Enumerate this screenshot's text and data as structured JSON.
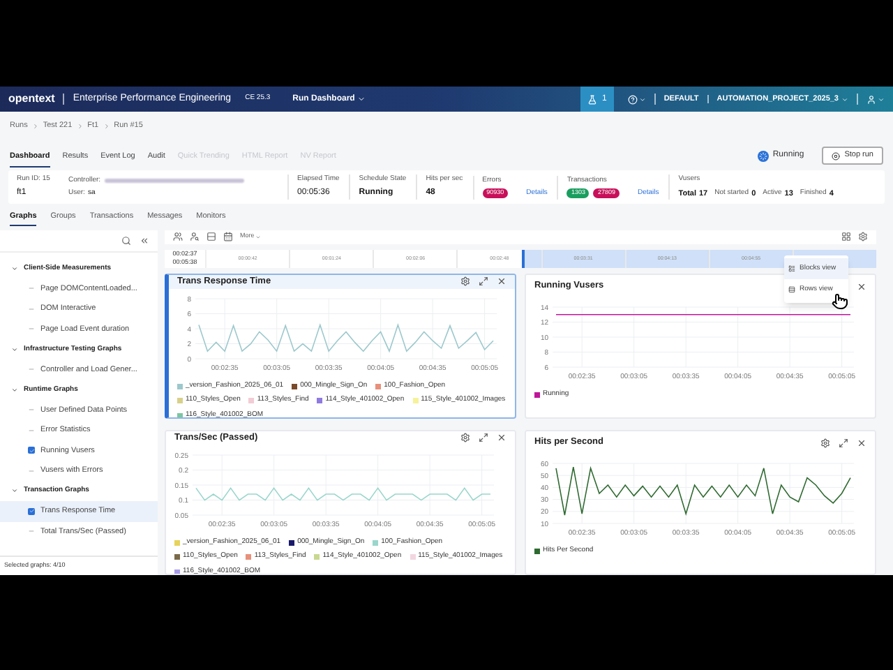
{
  "header": {
    "logo": "opentext",
    "product": "Enterprise Performance Engineering",
    "edition": "CE 25.3",
    "menu": "Run Dashboard",
    "notifications": "1",
    "domain": "DEFAULT",
    "project": "AUTOMATION_PROJECT_2025_3"
  },
  "breadcrumb": [
    "Runs",
    "Test 221",
    "Ft1",
    "Run #15"
  ],
  "tabs": [
    {
      "label": "Dashboard",
      "selected": true,
      "disabled": false
    },
    {
      "label": "Results",
      "selected": false,
      "disabled": false
    },
    {
      "label": "Event Log",
      "selected": false,
      "disabled": false
    },
    {
      "label": "Audit",
      "selected": false,
      "disabled": false
    },
    {
      "label": "Quick Trending",
      "selected": false,
      "disabled": true
    },
    {
      "label": "HTML Report",
      "selected": false,
      "disabled": true
    },
    {
      "label": "NV Report",
      "selected": false,
      "disabled": true
    }
  ],
  "run_status": "Running",
  "stop_button": "Stop run",
  "summary": {
    "run_id_label": "Run ID: 15",
    "run_name": "ft1",
    "controller_label": "Controller:",
    "user_label": "User:",
    "user": "sa",
    "elapsed_label": "Elapsed Time",
    "elapsed": "00:05:36",
    "schedule_label": "Schedule State",
    "schedule": "Running",
    "hits_label": "Hits per sec",
    "hits": "48",
    "errors_label": "Errors",
    "errors_badges": [
      {
        "text": "90930",
        "color": "#c8105a"
      }
    ],
    "errors_link": "Details",
    "transactions_label": "Transactions",
    "transactions_badges": [
      {
        "text": "1303",
        "color": "#1a9e5f"
      },
      {
        "text": "27809",
        "color": "#c8105a"
      }
    ],
    "transactions_link": "Details",
    "vusers_label": "Vusers",
    "vusers": [
      {
        "label": "Total",
        "value": "17"
      },
      {
        "label": "Not started",
        "value": "0"
      },
      {
        "label": "Active",
        "value": "13"
      },
      {
        "label": "Finished",
        "value": "4"
      }
    ]
  },
  "sub_tabs": [
    {
      "label": "Graphs",
      "selected": true
    },
    {
      "label": "Groups",
      "selected": false
    },
    {
      "label": "Transactions",
      "selected": false
    },
    {
      "label": "Messages",
      "selected": false
    },
    {
      "label": "Monitors",
      "selected": false
    }
  ],
  "sidebar": {
    "groups": [
      {
        "label": "Client-Side Measurements",
        "expanded": true,
        "children": [
          {
            "label": "Page DOMContentLoaded...",
            "checked": false,
            "selected": false
          },
          {
            "label": "DOM Interactive",
            "checked": false,
            "selected": false
          },
          {
            "label": "Page Load Event duration",
            "checked": false,
            "selected": false
          }
        ]
      },
      {
        "label": "Infrastructure Testing Graphs",
        "expanded": true,
        "children": [
          {
            "label": "Controller and Load Gener...",
            "checked": false,
            "selected": false
          }
        ]
      },
      {
        "label": "Runtime Graphs",
        "expanded": true,
        "children": [
          {
            "label": "User Defined Data Points",
            "checked": false,
            "selected": false
          },
          {
            "label": "Error Statistics",
            "checked": false,
            "selected": false
          },
          {
            "label": "Running Vusers",
            "checked": true,
            "selected": false
          },
          {
            "label": "Vusers with Errors",
            "checked": false,
            "selected": false
          }
        ]
      },
      {
        "label": "Transaction Graphs",
        "expanded": true,
        "children": [
          {
            "label": "Trans Response Time",
            "checked": true,
            "selected": true
          },
          {
            "label": "Total Trans/Sec (Passed)",
            "checked": false,
            "selected": false
          }
        ]
      }
    ],
    "footer": "Selected graphs: 4/10"
  },
  "toolbar": {
    "more": "More"
  },
  "timeline": {
    "start": "00:02:37",
    "end": "00:05:38",
    "level": 0.53,
    "ticks": [
      "00:00:42",
      "00:01:24",
      "00:02:06",
      "00:02:48",
      "00:03:31",
      "00:04:13",
      "00:04:55"
    ]
  },
  "view_menu": [
    {
      "label": "Blocks view",
      "selected": true
    },
    {
      "label": "Rows view",
      "selected": false
    }
  ],
  "charts": [
    {
      "title": "Trans Response Time",
      "selected": true,
      "chart_data": {
        "type": "line",
        "grid": true,
        "x": [
          140,
          145,
          150,
          155,
          160,
          165,
          170,
          175,
          180,
          185,
          190,
          195,
          200,
          205,
          210,
          215,
          220,
          225,
          230,
          235,
          240,
          245,
          250,
          255,
          260,
          265,
          270,
          275,
          280,
          285,
          290,
          295,
          300,
          305,
          310
        ],
        "xlim": [
          138,
          312
        ],
        "ylim": [
          0,
          8
        ],
        "yticks": [
          0,
          2,
          4,
          6,
          8
        ],
        "xticks": [
          {
            "value": 155,
            "label": "00:02:35"
          },
          {
            "value": 185,
            "label": "00:03:05"
          },
          {
            "value": 215,
            "label": "00:03:35"
          },
          {
            "value": 245,
            "label": "00:04:05"
          },
          {
            "value": 275,
            "label": "00:04:35"
          },
          {
            "value": 305,
            "label": "00:05:05"
          }
        ],
        "series": [
          {
            "name": "_version_Fashion_2025_06_01",
            "color": "#9cc8cc",
            "values": [
              4.5,
              1,
              2.2,
              1,
              4.4,
              1,
              2,
              3.6,
              2.5,
              1,
              4.4,
              1,
              2,
              1,
              4.5,
              1,
              2.4,
              3.6,
              2.2,
              1,
              2.4,
              3.6,
              1,
              4.5,
              1,
              2.2,
              3.6,
              2.4,
              1.4,
              4.4,
              1.4,
              2.4,
              3.5,
              1.2,
              2.4
            ]
          },
          {
            "name": "000_Mingle_Sign_On",
            "color": "#7a4a2a",
            "values": [
              null,
              null,
              null,
              null,
              null,
              null,
              null,
              null,
              null,
              null,
              null,
              null,
              null,
              null,
              null,
              null,
              null,
              null,
              null,
              null,
              null,
              null,
              null,
              null,
              null,
              null,
              null,
              null,
              null,
              null,
              null,
              null,
              null,
              null,
              null
            ]
          },
          {
            "name": "100_Fashion_Open",
            "color": "#e8907a",
            "values": [
              null,
              null,
              null,
              null,
              null,
              null,
              null,
              null,
              null,
              null,
              null,
              null,
              null,
              null,
              null,
              null,
              null,
              null,
              null,
              null,
              null,
              null,
              null,
              null,
              null,
              null,
              null,
              null,
              null,
              null,
              null,
              null,
              null,
              null,
              null
            ]
          },
          {
            "name": "110_Styles_Open",
            "color": "#d8d08a",
            "values": [
              null,
              null,
              null,
              null,
              null,
              null,
              null,
              null,
              null,
              null,
              null,
              null,
              null,
              null,
              null,
              null,
              null,
              null,
              null,
              null,
              null,
              null,
              null,
              null,
              null,
              null,
              null,
              null,
              null,
              null,
              null,
              null,
              null,
              null,
              null
            ]
          },
          {
            "name": "113_Styles_Find",
            "color": "#f2ccd6",
            "values": [
              null,
              null,
              null,
              null,
              null,
              null,
              null,
              null,
              null,
              null,
              null,
              null,
              null,
              null,
              null,
              null,
              null,
              null,
              null,
              null,
              null,
              null,
              null,
              null,
              null,
              null,
              null,
              null,
              null,
              null,
              null,
              null,
              null,
              null,
              null
            ]
          },
          {
            "name": "114_Style_401002_Open",
            "color": "#8f7ae0",
            "values": [
              null,
              null,
              null,
              null,
              null,
              null,
              null,
              null,
              null,
              null,
              null,
              null,
              null,
              null,
              null,
              null,
              null,
              null,
              null,
              null,
              null,
              null,
              null,
              null,
              null,
              null,
              null,
              null,
              null,
              null,
              null,
              null,
              null,
              null,
              null
            ]
          },
          {
            "name": "115_Style_401002_Images",
            "color": "#f6f29a",
            "values": [
              null,
              null,
              null,
              null,
              null,
              null,
              null,
              null,
              null,
              null,
              null,
              null,
              null,
              null,
              null,
              null,
              null,
              null,
              null,
              null,
              null,
              null,
              null,
              null,
              null,
              null,
              null,
              null,
              null,
              null,
              null,
              null,
              null,
              null,
              null
            ]
          },
          {
            "name": "116_Style_401002_BOM",
            "color": "#7cc6a0",
            "values": [
              null,
              null,
              null,
              null,
              null,
              null,
              null,
              null,
              null,
              null,
              null,
              null,
              null,
              null,
              null,
              null,
              null,
              null,
              null,
              null,
              null,
              null,
              null,
              null,
              null,
              null,
              null,
              null,
              null,
              null,
              null,
              null,
              null,
              null,
              null
            ]
          }
        ]
      }
    },
    {
      "title": "Running Vusers",
      "selected": false,
      "tools_covered": true,
      "chart_data": {
        "type": "line",
        "grid": true,
        "x": [
          140,
          145,
          150,
          155,
          160,
          165,
          170,
          175,
          180,
          185,
          190,
          195,
          200,
          205,
          210,
          215,
          220,
          225,
          230,
          235,
          240,
          245,
          250,
          255,
          260,
          265,
          270,
          275,
          280,
          285,
          290,
          295,
          300,
          305,
          310
        ],
        "xlim": [
          138,
          312
        ],
        "ylim": [
          6,
          14
        ],
        "yticks": [
          6,
          8,
          10,
          12,
          14
        ],
        "xticks": [
          {
            "value": 155,
            "label": "00:02:35"
          },
          {
            "value": 185,
            "label": "00:03:05"
          },
          {
            "value": 215,
            "label": "00:03:35"
          },
          {
            "value": 245,
            "label": "00:04:05"
          },
          {
            "value": 275,
            "label": "00:04:35"
          },
          {
            "value": 305,
            "label": "00:05:05"
          }
        ],
        "series": [
          {
            "name": "Running",
            "color": "#c0169a",
            "values": [
              13,
              13,
              13,
              13,
              13,
              13,
              13,
              13,
              13,
              13,
              13,
              13,
              13,
              13,
              13,
              13,
              13,
              13,
              13,
              13,
              13,
              13,
              13,
              13,
              13,
              13,
              13,
              13,
              13,
              13,
              13,
              13,
              13,
              13,
              13
            ]
          }
        ]
      }
    },
    {
      "title": "Trans/Sec (Passed)",
      "selected": false,
      "chart_data": {
        "type": "line",
        "grid": true,
        "x": [
          140,
          145,
          150,
          155,
          160,
          165,
          170,
          175,
          180,
          185,
          190,
          195,
          200,
          205,
          210,
          215,
          220,
          225,
          230,
          235,
          240,
          245,
          250,
          255,
          260,
          265,
          270,
          275,
          280,
          285,
          290,
          295,
          300,
          305,
          310
        ],
        "xlim": [
          138,
          312
        ],
        "ylim": [
          0.05,
          0.25
        ],
        "yticks": [
          0.05,
          0.1,
          0.15,
          0.2,
          0.25
        ],
        "xticks": [
          {
            "value": 155,
            "label": "00:02:35"
          },
          {
            "value": 185,
            "label": "00:03:05"
          },
          {
            "value": 215,
            "label": "00:03:35"
          },
          {
            "value": 245,
            "label": "00:04:05"
          },
          {
            "value": 275,
            "label": "00:04:35"
          },
          {
            "value": 305,
            "label": "00:05:05"
          }
        ],
        "series": [
          {
            "name": "_version_Fashion_2025_06_01",
            "color": "#e6d35a",
            "values": [
              null,
              null,
              null,
              null,
              null,
              null,
              null,
              null,
              null,
              null,
              null,
              null,
              null,
              null,
              null,
              null,
              null,
              null,
              null,
              null,
              null,
              null,
              null,
              null,
              null,
              null,
              null,
              null,
              null,
              null,
              null,
              null,
              null,
              null,
              null
            ]
          },
          {
            "name": "000_Mingle_Sign_On",
            "color": "#1a1a6a",
            "values": [
              null,
              null,
              null,
              null,
              null,
              null,
              null,
              null,
              null,
              null,
              null,
              null,
              null,
              null,
              null,
              null,
              null,
              null,
              null,
              null,
              null,
              null,
              null,
              null,
              null,
              null,
              null,
              null,
              null,
              null,
              null,
              null,
              null,
              null,
              null
            ]
          },
          {
            "name": "100_Fashion_Open",
            "color": "#9ad6cc",
            "values": [
              0.14,
              0.1,
              0.12,
              0.1,
              0.14,
              0.1,
              0.12,
              0.12,
              0.1,
              0.14,
              0.1,
              0.12,
              0.1,
              0.14,
              0.1,
              0.12,
              0.12,
              0.1,
              0.12,
              0.12,
              0.1,
              0.14,
              0.1,
              0.12,
              0.12,
              0.12,
              0.1,
              0.12,
              0.12,
              0.12,
              0.1,
              0.14,
              0.1,
              0.12,
              0.12
            ]
          },
          {
            "name": "110_Styles_Open",
            "color": "#7a6a4a",
            "values": [
              null,
              null,
              null,
              null,
              null,
              null,
              null,
              null,
              null,
              null,
              null,
              null,
              null,
              null,
              null,
              null,
              null,
              null,
              null,
              null,
              null,
              null,
              null,
              null,
              null,
              null,
              null,
              null,
              null,
              null,
              null,
              null,
              null,
              null,
              null
            ]
          },
          {
            "name": "113_Styles_Find",
            "color": "#e8907a",
            "values": [
              null,
              null,
              null,
              null,
              null,
              null,
              null,
              null,
              null,
              null,
              null,
              null,
              null,
              null,
              null,
              null,
              null,
              null,
              null,
              null,
              null,
              null,
              null,
              null,
              null,
              null,
              null,
              null,
              null,
              null,
              null,
              null,
              null,
              null,
              null
            ]
          },
          {
            "name": "114_Style_401002_Open",
            "color": "#c8d890",
            "values": [
              null,
              null,
              null,
              null,
              null,
              null,
              null,
              null,
              null,
              null,
              null,
              null,
              null,
              null,
              null,
              null,
              null,
              null,
              null,
              null,
              null,
              null,
              null,
              null,
              null,
              null,
              null,
              null,
              null,
              null,
              null,
              null,
              null,
              null,
              null
            ]
          },
          {
            "name": "115_Style_401002_Images",
            "color": "#f2d6e0",
            "values": [
              null,
              null,
              null,
              null,
              null,
              null,
              null,
              null,
              null,
              null,
              null,
              null,
              null,
              null,
              null,
              null,
              null,
              null,
              null,
              null,
              null,
              null,
              null,
              null,
              null,
              null,
              null,
              null,
              null,
              null,
              null,
              null,
              null,
              null,
              null
            ]
          },
          {
            "name": "116_Style_401002_BOM",
            "color": "#a89ae8",
            "values": [
              null,
              null,
              null,
              null,
              null,
              null,
              null,
              null,
              null,
              null,
              null,
              null,
              null,
              null,
              null,
              null,
              null,
              null,
              null,
              null,
              null,
              null,
              null,
              null,
              null,
              null,
              null,
              null,
              null,
              null,
              null,
              null,
              null,
              null,
              null
            ]
          }
        ]
      }
    },
    {
      "title": "Hits per Second",
      "selected": false,
      "chart_data": {
        "type": "line",
        "grid": true,
        "x": [
          140,
          145,
          150,
          155,
          160,
          165,
          170,
          175,
          180,
          185,
          190,
          195,
          200,
          205,
          210,
          215,
          220,
          225,
          230,
          235,
          240,
          245,
          250,
          255,
          260,
          265,
          270,
          275,
          280,
          285,
          290,
          295,
          300,
          305,
          310
        ],
        "xlim": [
          138,
          312
        ],
        "ylim": [
          10,
          60
        ],
        "yticks": [
          10,
          20,
          30,
          40,
          50,
          60
        ],
        "xticks": [
          {
            "value": 155,
            "label": "00:02:35"
          },
          {
            "value": 185,
            "label": "00:03:05"
          },
          {
            "value": 215,
            "label": "00:03:35"
          },
          {
            "value": 245,
            "label": "00:04:05"
          },
          {
            "value": 275,
            "label": "00:04:35"
          },
          {
            "value": 305,
            "label": "00:05:05"
          }
        ],
        "series": [
          {
            "name": "Hits Per Second",
            "color": "#2e6a30",
            "values": [
              56,
              17,
              57,
              18,
              56,
              35,
              42,
              32,
              42,
              33,
              41,
              32,
              41,
              32,
              42,
              18,
              42,
              32,
              41,
              32,
              42,
              32,
              42,
              33,
              56,
              18,
              42,
              32,
              28,
              48,
              42,
              33,
              27,
              35,
              48
            ]
          }
        ]
      }
    }
  ]
}
